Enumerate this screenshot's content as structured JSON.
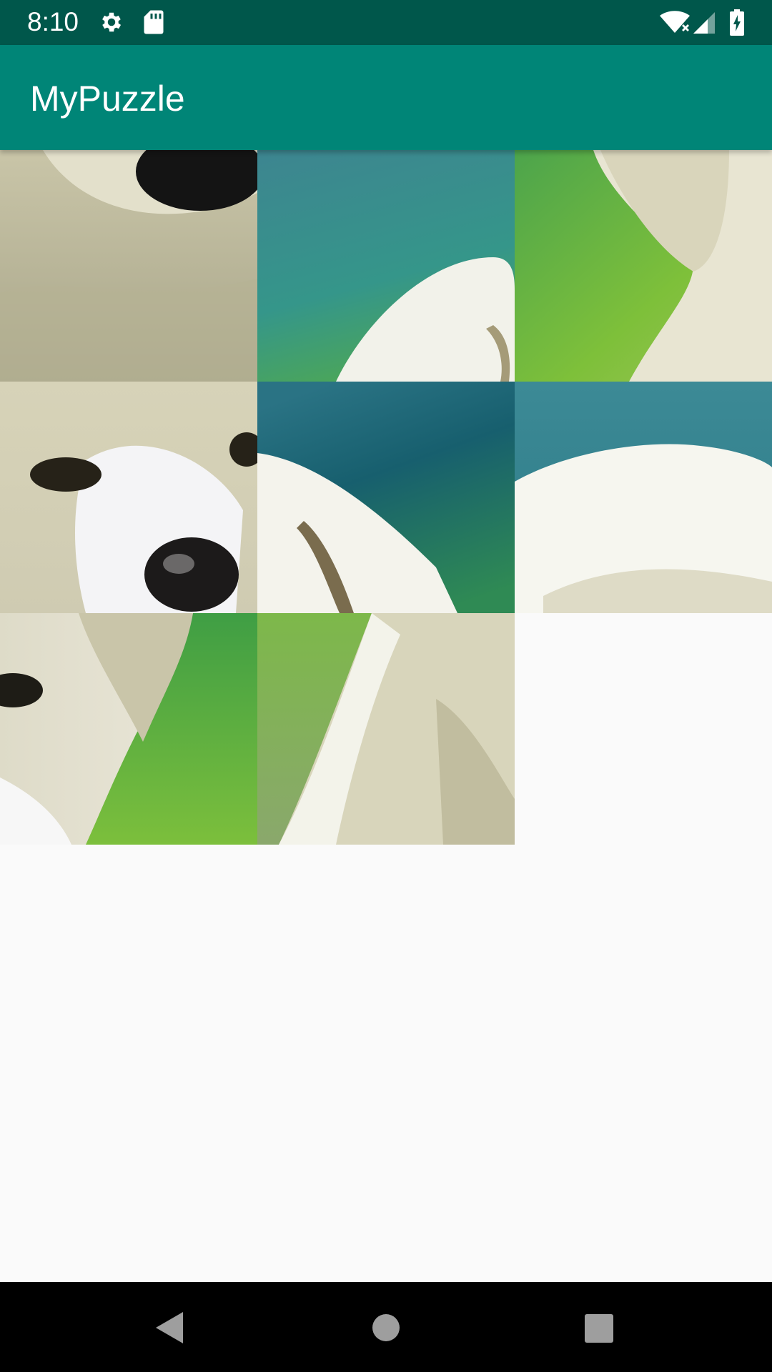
{
  "status_bar": {
    "time": "8:10",
    "icons": [
      "gear-icon",
      "sd-card-icon",
      "wifi-icon",
      "cell-signal-icon",
      "battery-charging-icon"
    ]
  },
  "app_bar": {
    "title": "MyPuzzle"
  },
  "puzzle": {
    "rows": 3,
    "columns": 3,
    "tiles": [
      {
        "row": 0,
        "col": 0,
        "content": "puppy-face-nose-fur"
      },
      {
        "row": 0,
        "col": 1,
        "content": "teal-background-paw"
      },
      {
        "row": 0,
        "col": 2,
        "content": "green-background-ear"
      },
      {
        "row": 1,
        "col": 0,
        "content": "puppy-eye-nose"
      },
      {
        "row": 1,
        "col": 1,
        "content": "teal-background-ear-edge"
      },
      {
        "row": 1,
        "col": 2,
        "content": "teal-background-fur"
      },
      {
        "row": 2,
        "col": 0,
        "content": "puppy-eye-ear-green"
      },
      {
        "row": 2,
        "col": 1,
        "content": "green-background-body"
      },
      {
        "row": 2,
        "col": 2,
        "content": "empty"
      }
    ]
  },
  "nav_bar": {
    "buttons": [
      "back-icon",
      "home-icon",
      "recents-icon"
    ]
  }
}
